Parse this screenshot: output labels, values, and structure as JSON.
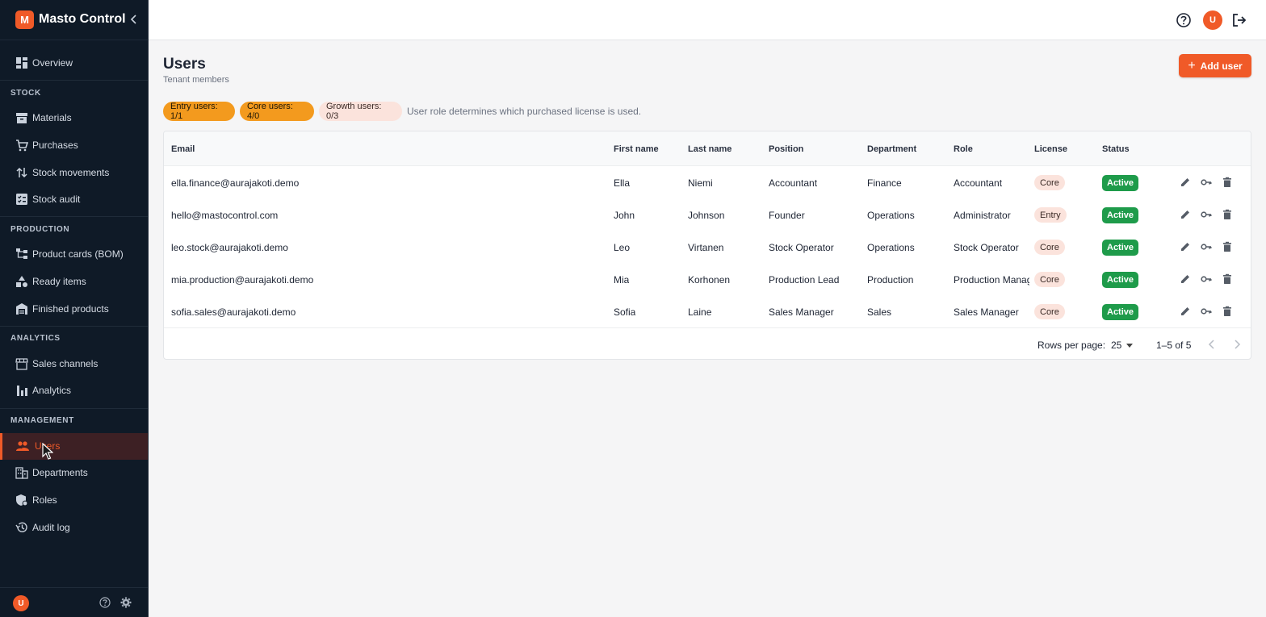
{
  "app": {
    "logo_letter": "M",
    "name": "Masto Control"
  },
  "sidebar": {
    "overview": "Overview",
    "sections": {
      "stock": "STOCK",
      "production": "PRODUCTION",
      "analytics": "ANALYTICS",
      "management": "MANAGEMENT"
    },
    "items": {
      "materials": "Materials",
      "purchases": "Purchases",
      "stock_movements": "Stock movements",
      "stock_audit": "Stock audit",
      "product_cards": "Product cards (BOM)",
      "ready_items": "Ready items",
      "finished_products": "Finished products",
      "sales_channels": "Sales channels",
      "analytics": "Analytics",
      "users": "Users",
      "departments": "Departments",
      "roles": "Roles",
      "audit_log": "Audit log"
    },
    "active_item": "users",
    "footer_avatar": "U"
  },
  "topbar": {
    "avatar": "U"
  },
  "page": {
    "title": "Users",
    "subtitle": "Tenant members",
    "add_button": "Add user",
    "add_button_icon": "+"
  },
  "license_chips": {
    "entry": "Entry users: 1/1",
    "core": "Core users: 4/0",
    "growth": "Growth users: 0/3",
    "note": "User role determines which purchased license is used."
  },
  "table": {
    "columns": {
      "email": "Email",
      "first_name": "First name",
      "last_name": "Last name",
      "position": "Position",
      "department": "Department",
      "role": "Role",
      "license": "License",
      "status": "Status"
    },
    "rows": [
      {
        "email": "ella.finance@aurajakoti.demo",
        "first_name": "Ella",
        "last_name": "Niemi",
        "position": "Accountant",
        "department": "Finance",
        "role": "Accountant",
        "license": "Core",
        "status": "Active"
      },
      {
        "email": "hello@mastocontrol.com",
        "first_name": "John",
        "last_name": "Johnson",
        "position": "Founder",
        "department": "Operations",
        "role": "Administrator",
        "license": "Entry",
        "status": "Active"
      },
      {
        "email": "leo.stock@aurajakoti.demo",
        "first_name": "Leo",
        "last_name": "Virtanen",
        "position": "Stock Operator",
        "department": "Operations",
        "role": "Stock Operator",
        "license": "Core",
        "status": "Active"
      },
      {
        "email": "mia.production@aurajakoti.demo",
        "first_name": "Mia",
        "last_name": "Korhonen",
        "position": "Production Lead",
        "department": "Production",
        "role": "Production Manag",
        "license": "Core",
        "status": "Active"
      },
      {
        "email": "sofia.sales@aurajakoti.demo",
        "first_name": "Sofia",
        "last_name": "Laine",
        "position": "Sales Manager",
        "department": "Sales",
        "role": "Sales Manager",
        "license": "Core",
        "status": "Active"
      }
    ],
    "pagination": {
      "rows_per_page_label": "Rows per page:",
      "rows_per_page": "25",
      "range": "1–5 of 5"
    }
  },
  "colors": {
    "accent": "#f05a28",
    "sidebar_bg": "#0f1a27",
    "active_status": "#1e9b4a",
    "chip_orange": "#f39a1e"
  }
}
